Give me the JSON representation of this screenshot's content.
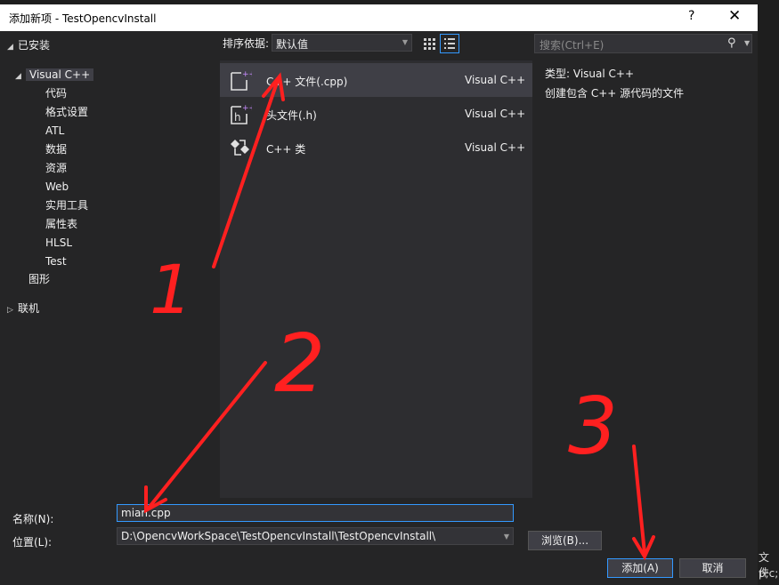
{
  "dialog": {
    "title": "添加新项 - TestOpencvInstall",
    "help_label": "?",
    "close_label": "✕"
  },
  "tree": {
    "installed": "已安装",
    "visual_cpp": "Visual C++",
    "children": [
      "代码",
      "格式设置",
      "ATL",
      "数据",
      "资源",
      "Web",
      "实用工具",
      "属性表",
      "HLSL",
      "Test"
    ],
    "graphics": "图形",
    "online": "联机"
  },
  "toolbar": {
    "sort_label": "排序依据:",
    "sort_value": "默认值",
    "search_placeholder": "搜索(Ctrl+E)"
  },
  "templates": [
    {
      "name": "C++ 文件(.cpp)",
      "lang": "Visual C++",
      "icon": "cpp-file-icon"
    },
    {
      "name": "头文件(.h)",
      "lang": "Visual C++",
      "icon": "header-file-icon"
    },
    {
      "name": "C++ 类",
      "lang": "Visual C++",
      "icon": "cpp-class-icon"
    }
  ],
  "details": {
    "type_label": "类型:",
    "type_value": "Visual C++",
    "description": "创建包含 C++ 源代码的文件"
  },
  "form": {
    "name_label": "名称(N):",
    "name_value": "mian.cpp",
    "location_label": "位置(L):",
    "location_value": "D:\\OpencvWorkSpace\\TestOpencvInstall\\TestOpencvInstall\\",
    "browse_label": "浏览(B)...",
    "add_label": "添加(A)",
    "cancel_label": "取消"
  },
  "background": {
    "file_label": "文件",
    "cut_text": "p;c;c"
  },
  "annotations": [
    "1",
    "2",
    "3"
  ],
  "colors": {
    "accent": "#3399ff",
    "annotation": "#ff2020"
  }
}
